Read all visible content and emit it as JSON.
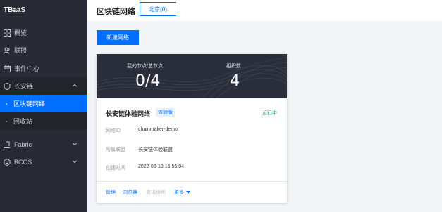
{
  "app": {
    "name": "TBaaS"
  },
  "sidebar": {
    "items": [
      {
        "label": "概览",
        "icon": "grid-icon"
      },
      {
        "label": "联盟",
        "icon": "people-icon"
      },
      {
        "label": "事件中心",
        "icon": "calendar-icon"
      },
      {
        "label": "长安链",
        "icon": "shield-icon",
        "expanded": true,
        "children": [
          {
            "label": "区块链网络",
            "active": true
          },
          {
            "label": "回收站"
          }
        ]
      },
      {
        "label": "Fabric",
        "icon": "fabric-icon"
      },
      {
        "label": "BCOS",
        "icon": "gear-icon"
      }
    ]
  },
  "header": {
    "title": "区块链网络",
    "region_button": "北京(0)"
  },
  "toolbar": {
    "create_label": "新建网络"
  },
  "card": {
    "stats": [
      {
        "label": "我的节点/总节点",
        "value": "0/4"
      },
      {
        "label": "组织数",
        "value": "4"
      }
    ],
    "name": "长安链体验网络",
    "badge": "体验版",
    "status": "运行中",
    "fields": [
      {
        "label": "网络ID",
        "value": "chainmaker-demo"
      },
      {
        "label": "所属联盟",
        "value": "长安链体验联盟"
      },
      {
        "label": "创建时间",
        "value": "2022-06-13 16:55:04"
      }
    ],
    "actions": [
      {
        "label": "管理",
        "enabled": true
      },
      {
        "label": "浏览器",
        "enabled": true
      },
      {
        "label": "邀请组织",
        "enabled": false
      },
      {
        "label": "更多",
        "enabled": true
      }
    ]
  },
  "colors": {
    "accent": "#006eff",
    "sidebar_bg": "#282b33",
    "status_green": "#0abf5b"
  }
}
